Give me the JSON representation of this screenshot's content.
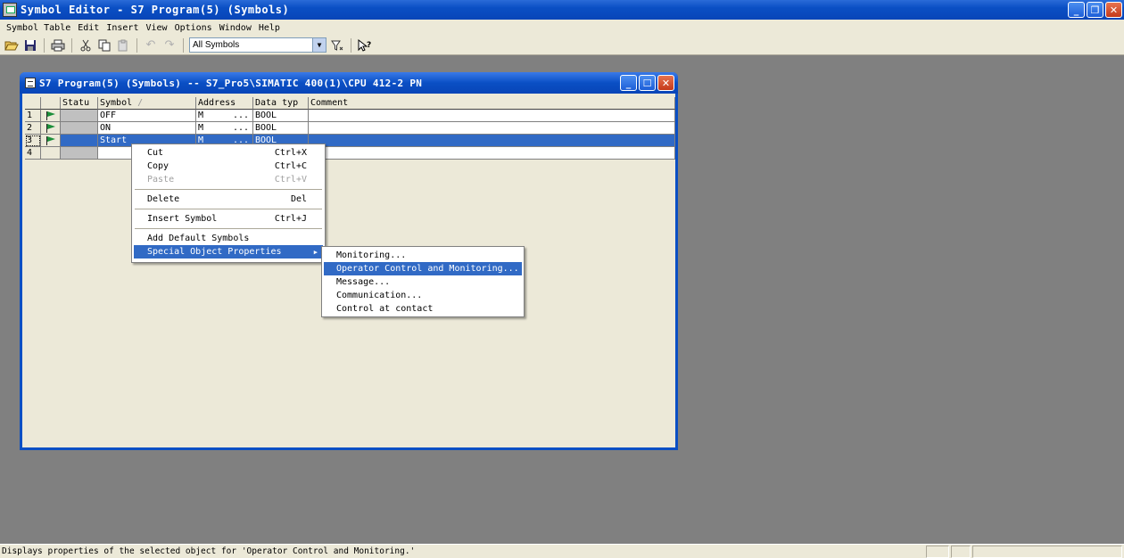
{
  "app": {
    "title": "Symbol Editor - S7 Program(5) (Symbols)",
    "buttons": {
      "minimize": "_",
      "restore": "❐",
      "close": "✕"
    }
  },
  "menubar": {
    "items": [
      {
        "label": "Symbol Table"
      },
      {
        "label": "Edit"
      },
      {
        "label": "Insert"
      },
      {
        "label": "View"
      },
      {
        "label": "Options"
      },
      {
        "label": "Window"
      },
      {
        "label": "Help"
      }
    ]
  },
  "toolbar": {
    "icons": {
      "open": "open-folder-icon",
      "save": "save-icon",
      "print": "print-icon",
      "cut": "cut-icon",
      "copy": "copy-icon",
      "paste": "paste-icon",
      "undo": "undo-icon",
      "redo": "redo-icon",
      "filter": "filter-icon",
      "help": "context-help-icon"
    },
    "filter_value": "All Symbols"
  },
  "child_window": {
    "title": "S7 Program(5) (Symbols) -- S7_Pro5\\SIMATIC 400(1)\\CPU 412-2 PN"
  },
  "table": {
    "columns": {
      "status": "Statu",
      "symbol": "Symbol",
      "symbol_sort": "/",
      "address": "Address",
      "datatype": "Data typ",
      "comment": "Comment"
    },
    "rows": [
      {
        "num": "1",
        "symbol": "OFF",
        "addr_prefix": "M",
        "addr_value": "...",
        "datatype": "BOOL",
        "comment": ""
      },
      {
        "num": "2",
        "symbol": "ON",
        "addr_prefix": "M",
        "addr_value": "...",
        "datatype": "BOOL",
        "comment": ""
      },
      {
        "num": "3",
        "symbol": "Start",
        "addr_prefix": "M",
        "addr_value": "...",
        "datatype": "BOOL",
        "comment": ""
      },
      {
        "num": "4",
        "symbol": "",
        "addr_prefix": "",
        "addr_value": "",
        "datatype": "",
        "comment": ""
      }
    ]
  },
  "context_menu": {
    "cut": {
      "label": "Cut",
      "shortcut": "Ctrl+X"
    },
    "copy": {
      "label": "Copy",
      "shortcut": "Ctrl+C"
    },
    "paste": {
      "label": "Paste",
      "shortcut": "Ctrl+V"
    },
    "delete": {
      "label": "Delete",
      "shortcut": "Del"
    },
    "insert_symbol": {
      "label": "Insert Symbol",
      "shortcut": "Ctrl+J"
    },
    "add_default": {
      "label": "Add Default Symbols"
    },
    "special": {
      "label": "Special Object Properties",
      "arrow": "▶"
    }
  },
  "submenu": {
    "items": [
      {
        "label": "Monitoring..."
      },
      {
        "label": "Operator Control and Monitoring..."
      },
      {
        "label": "Message..."
      },
      {
        "label": "Communication..."
      },
      {
        "label": "Control at contact"
      }
    ]
  },
  "statusbar": {
    "text": "Displays properties of the selected object for 'Operator Control and Monitoring.'"
  }
}
